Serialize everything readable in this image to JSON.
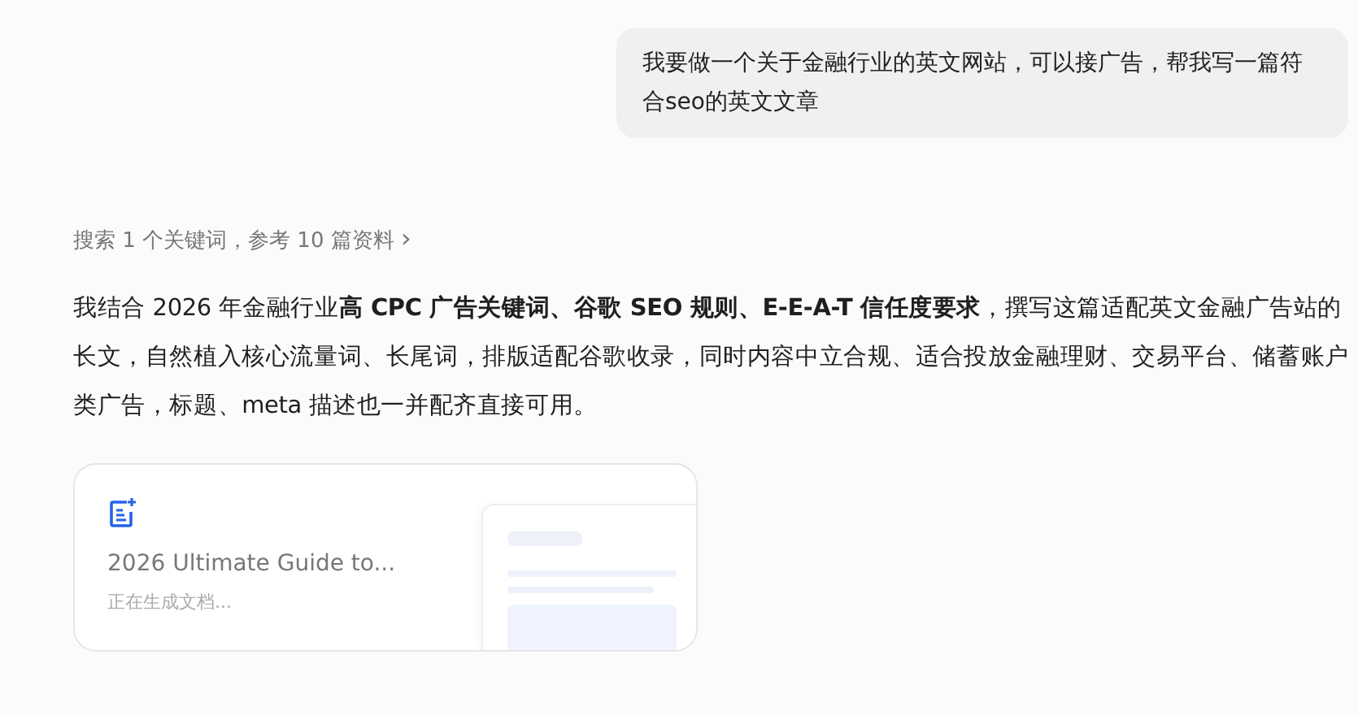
{
  "user_message": {
    "text": "我要做一个关于金融行业的英文网站，可以接广告，帮我写一篇符合seo的英文文章"
  },
  "search_summary": {
    "text": "搜索 1 个关键词，参考 10 篇资料",
    "chevron": "›"
  },
  "answer": {
    "text": "我结合 2026 年金融行业**高 CPC 广告关键词、谷歌 SEO 规则、E-E-A-T 信任度要求**，撰写这篇适配英文金融广告站的长文，自然植入核心流量词、长尾词，排版适配谷歌收录，同时内容中立合规、适合投放金融理财、交易平台、储蓄账户类广告，标题、meta 描述也一并配齐直接可用。"
  },
  "document_card": {
    "title": "2026 Ultimate Guide to...",
    "status": "正在生成文档..."
  }
}
